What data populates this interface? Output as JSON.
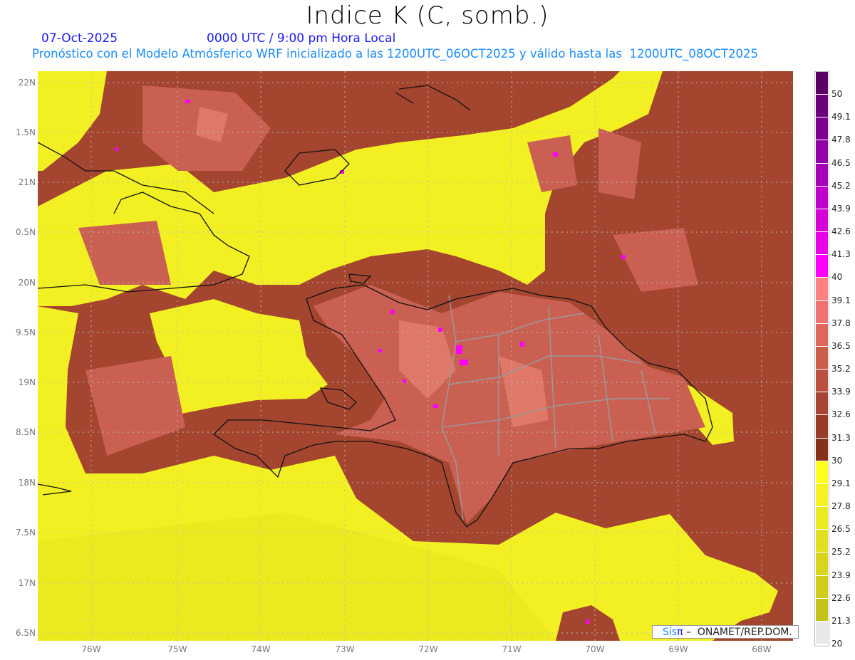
{
  "title": "Indice K (C, somb.)",
  "date": "07-Oct-2025",
  "time": "0000 UTC / 9:00 pm Hora Local",
  "subtitle": "Pronóstico con el Modelo Atmósferico WRF inicializado a las 1200UTC_06OCT2025 y válido hasta las  1200UTC_08OCT2025",
  "lat_labels": [
    "22N",
    "1.5N",
    "21N",
    "0.5N",
    "20N",
    "9.5N",
    "19N",
    "8.5N",
    "18N",
    "7.5N",
    "17N",
    "6.5N"
  ],
  "lon_labels": [
    "76W",
    "75W",
    "74W",
    "73W",
    "72W",
    "71W",
    "70W",
    "69W",
    "68W"
  ],
  "colorbar": {
    "labels": [
      "50",
      "49.1",
      "47.8",
      "46.5",
      "45.2",
      "43.9",
      "42.6",
      "41.3",
      "40",
      "39.1",
      "37.8",
      "36.5",
      "35.2",
      "33.9",
      "32.6",
      "31.3",
      "30",
      "29.1",
      "27.8",
      "26.5",
      "25.2",
      "23.9",
      "22.6",
      "21.3",
      "20"
    ],
    "colors": [
      "#5c0066",
      "#6c007c",
      "#7e0090",
      "#9000a6",
      "#a800ba",
      "#c000cc",
      "#d600d8",
      "#e800e8",
      "#ff00ff",
      "#ff8080",
      "#ee7272",
      "#de665c",
      "#cc5c4c",
      "#bb5040",
      "#a84434",
      "#983c28",
      "#86301a",
      "#ffff20",
      "#f5f220",
      "#ebe920",
      "#e2df1e",
      "#d9d51c",
      "#cfcc1a",
      "#c4c418",
      "#e8e8e8"
    ]
  },
  "colors": {
    "yellow": "#f2f022",
    "brown": "#a4452f",
    "dark_brown": "#8a3418",
    "salmon": "#c96052",
    "light_salmon": "#e07868",
    "magenta": "#ff00ff"
  },
  "logo": {
    "brand_a": "Sis",
    "brand_b": "π",
    "text": " –  ONAMET/REP.DOM."
  }
}
